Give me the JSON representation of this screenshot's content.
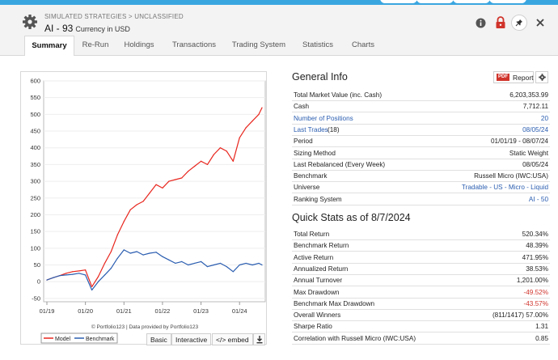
{
  "header": {
    "breadcrumb": "SIMULATED STRATEGIES > UNCLASSIFIED",
    "title": "AI - 93",
    "currency": "Currency in USD"
  },
  "tabs": [
    {
      "label": "Summary",
      "active": true
    },
    {
      "label": "Re-Run"
    },
    {
      "label": "Holdings"
    },
    {
      "label": "Transactions"
    },
    {
      "label": "Trading System"
    },
    {
      "label": "Statistics"
    },
    {
      "label": "Charts"
    }
  ],
  "chart_data": {
    "type": "line",
    "yticks": [
      600,
      550,
      500,
      450,
      400,
      350,
      300,
      250,
      200,
      150,
      100,
      50,
      0,
      -50
    ],
    "xticks": [
      "01/19",
      "01/20",
      "01/21",
      "01/22",
      "01/23",
      "01/24"
    ],
    "ylim": [
      -60,
      600
    ],
    "credit": "© Portfolio123 | Data provided by Portfolio123",
    "series": [
      {
        "name": "Model",
        "color": "#e8261e",
        "x": [
          "01/19",
          "03/19",
          "05/19",
          "07/19",
          "09/19",
          "11/19",
          "01/20",
          "03/20",
          "05/20",
          "07/20",
          "09/20",
          "11/20",
          "01/21",
          "03/21",
          "05/21",
          "07/21",
          "09/21",
          "11/21",
          "01/22",
          "03/22",
          "05/22",
          "07/22",
          "09/22",
          "11/22",
          "01/23",
          "03/23",
          "05/23",
          "07/23",
          "09/23",
          "11/23",
          "01/24",
          "03/24",
          "05/24",
          "07/24",
          "08/24"
        ],
        "y": [
          5,
          12,
          18,
          25,
          30,
          32,
          35,
          -15,
          15,
          55,
          90,
          140,
          180,
          215,
          230,
          240,
          265,
          290,
          280,
          300,
          305,
          310,
          330,
          345,
          360,
          350,
          380,
          400,
          390,
          360,
          430,
          460,
          480,
          500,
          520
        ]
      },
      {
        "name": "Benchmark",
        "color": "#2a5db0",
        "x": [
          "01/19",
          "03/19",
          "05/19",
          "07/19",
          "09/19",
          "11/19",
          "01/20",
          "03/20",
          "05/20",
          "07/20",
          "09/20",
          "11/20",
          "01/21",
          "03/21",
          "05/21",
          "07/21",
          "09/21",
          "11/21",
          "01/22",
          "03/22",
          "05/22",
          "07/22",
          "09/22",
          "11/22",
          "01/23",
          "03/23",
          "05/23",
          "07/23",
          "09/23",
          "11/23",
          "01/24",
          "03/24",
          "05/24",
          "07/24",
          "08/24"
        ],
        "y": [
          5,
          12,
          18,
          20,
          22,
          25,
          20,
          -25,
          0,
          20,
          40,
          70,
          95,
          85,
          90,
          80,
          85,
          88,
          75,
          65,
          55,
          60,
          50,
          55,
          60,
          45,
          50,
          55,
          45,
          30,
          50,
          55,
          50,
          55,
          50
        ]
      }
    ]
  },
  "chart_buttons": {
    "basic": "Basic",
    "interactive": "Interactive",
    "embed": "</> embed"
  },
  "general": {
    "title": "General Info",
    "report_label": "Report",
    "pdf_label": "PDF",
    "rows": [
      {
        "k": "Total Market Value (inc. Cash)",
        "v": "6,203,353.99"
      },
      {
        "k": "Cash",
        "v": "7,712.11"
      },
      {
        "k": "Number of Positions",
        "v": "20"
      },
      {
        "k": "Last Trades",
        "extra": "(18)",
        "v": "08/05/24"
      },
      {
        "k": "Period",
        "v": "01/01/19 - 08/07/24"
      },
      {
        "k": "Sizing Method",
        "v": "Static Weight"
      },
      {
        "k": "Last Rebalanced (Every Week)",
        "v": "08/05/24"
      },
      {
        "k": "Benchmark",
        "v": "Russell Micro (IWC:USA)"
      },
      {
        "k": "Universe",
        "v": "Tradable - US - Micro - Liquid"
      },
      {
        "k": "Ranking System",
        "v": "AI - 50"
      }
    ]
  },
  "quick": {
    "title": "Quick Stats as of 8/7/2024",
    "rows": [
      {
        "k": "Total Return",
        "v": "520.34%"
      },
      {
        "k": "Benchmark Return",
        "v": "48.39%"
      },
      {
        "k": "Active Return",
        "v": "471.95%"
      },
      {
        "k": "Annualized Return",
        "v": "38.53%"
      },
      {
        "k": "Annual Turnover",
        "v": "1,201.00%"
      },
      {
        "k": "Max Drawdown",
        "v": "-49.52%"
      },
      {
        "k": "Benchmark Max Drawdown",
        "v": "-43.57%"
      },
      {
        "k": "Overall Winners",
        "v": "(811/1417) 57.00%"
      },
      {
        "k": "Sharpe Ratio",
        "v": "1.31"
      },
      {
        "k": "Correlation with Russell Micro (IWC:USA)",
        "v": "0.85"
      }
    ]
  },
  "icons": {
    "gear": "gear-icon",
    "info": "info-icon",
    "lock": "lock-icon",
    "pin": "pin-icon",
    "close": "close-icon",
    "download": "download-icon"
  }
}
